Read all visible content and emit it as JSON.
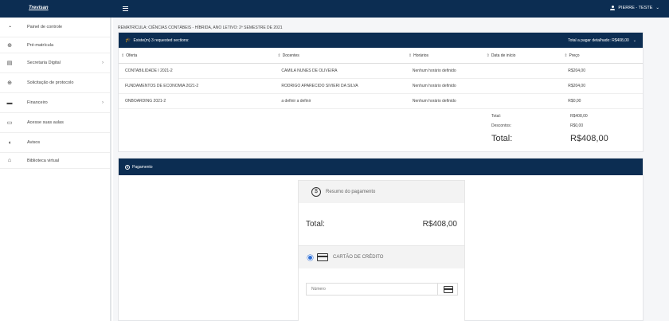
{
  "topbar": {
    "logo": "Trevisan",
    "user_label": "PIERRE - TESTE",
    "user_chevron": "⌄"
  },
  "sidebar": {
    "items": [
      {
        "label": "Painel de controle",
        "icon": "◔"
      },
      {
        "label": "Pré-matrícula",
        "icon": "⊕"
      },
      {
        "label": "Secretaria Digital",
        "icon": "▤",
        "chevron": "›"
      },
      {
        "label": "Solicitação de protocolo",
        "icon": "⊕"
      },
      {
        "label": "Financeiro",
        "icon": "▬",
        "chevron": "›"
      },
      {
        "label": "Acesse suas aulas",
        "icon": "▭"
      },
      {
        "label": "Avisos",
        "icon": "◖"
      },
      {
        "label": "Biblioteca virtual",
        "icon": "⌂"
      }
    ]
  },
  "breadcrumb": "REMATRÍCULA: CIÊNCIAS CONTÁBEIS - HÍBRIDA, ANO LETIVO: 2º SEMESTRE DE 2021",
  "sections_panel": {
    "header_left": "Existe(m) 3 requested sections:",
    "header_right": "Total a pagar detalhado: R$408,00",
    "header_chevron": "⌄",
    "columns": [
      "Oferta",
      "Docentes",
      "Horários",
      "Data de início",
      "Preço"
    ],
    "rows": [
      [
        "CONTABILIDADE I 2021-2",
        "CAMILA NUNES DE OLIVEIRA",
        "Nenhum horário definido",
        "",
        "R$204,00"
      ],
      [
        "FUNDAMENTOS DE ECONOMIA 2021-2",
        "RODRIGO APARECIDO SIVIERI DA SILVA",
        "Nenhum horário definido",
        "",
        "R$204,00"
      ],
      [
        "ONBOARDING 2021-2",
        "a definir a definir",
        "Nenhum horário definido",
        "",
        "R$0,00"
      ]
    ],
    "totals": {
      "total_label": "Total:",
      "total_value": "R$408,00",
      "discount_label": "Descontos:",
      "discount_value": "R$0,00",
      "big_total_label": "Total:",
      "big_total_value": "R$408,00"
    }
  },
  "payment": {
    "header": "Pagamento",
    "summary_label": "Resumo do pagamento",
    "total_label": "Total:",
    "total_value": "R$408,00",
    "method_label": "CARTÃO DE CRÉDITO",
    "number_placeholder": "Número"
  }
}
